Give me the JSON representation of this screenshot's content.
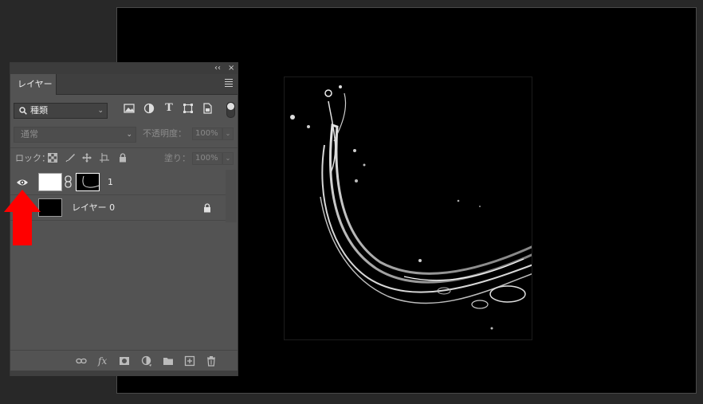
{
  "panel": {
    "collapse_glyph": "‹‹",
    "close_glyph": "×",
    "tab_label": "レイヤー",
    "menu_icon": "hamburger-icon"
  },
  "filter": {
    "kind_label": "種類",
    "kind_icon": "search-icon",
    "filter_icons": [
      "image-filter-icon",
      "adjustment-filter-icon",
      "type-filter-icon",
      "shape-filter-icon",
      "smart-object-filter-icon"
    ],
    "type_glyph": "T"
  },
  "blend": {
    "mode": "通常",
    "opacity_label": "不透明度：",
    "opacity_value": "100%"
  },
  "lock": {
    "label": "ロック：",
    "fill_label": "塗り：",
    "fill_value": "100%"
  },
  "layers": [
    {
      "name": "1",
      "visible": true,
      "has_mask": true
    },
    {
      "name": "レイヤー 0",
      "visible": false,
      "locked": true
    }
  ],
  "bottom_tools": {
    "fx_label": "fx",
    "icons": [
      "link-layers-icon",
      "fx-icon",
      "add-mask-icon",
      "adjustment-layer-icon",
      "new-group-icon",
      "new-layer-icon",
      "trash-icon"
    ]
  },
  "colors": {
    "panel_bg": "#535353",
    "canvas_bg": "#000000",
    "workspace_bg": "#282828",
    "annotation_arrow": "#ff0000"
  }
}
